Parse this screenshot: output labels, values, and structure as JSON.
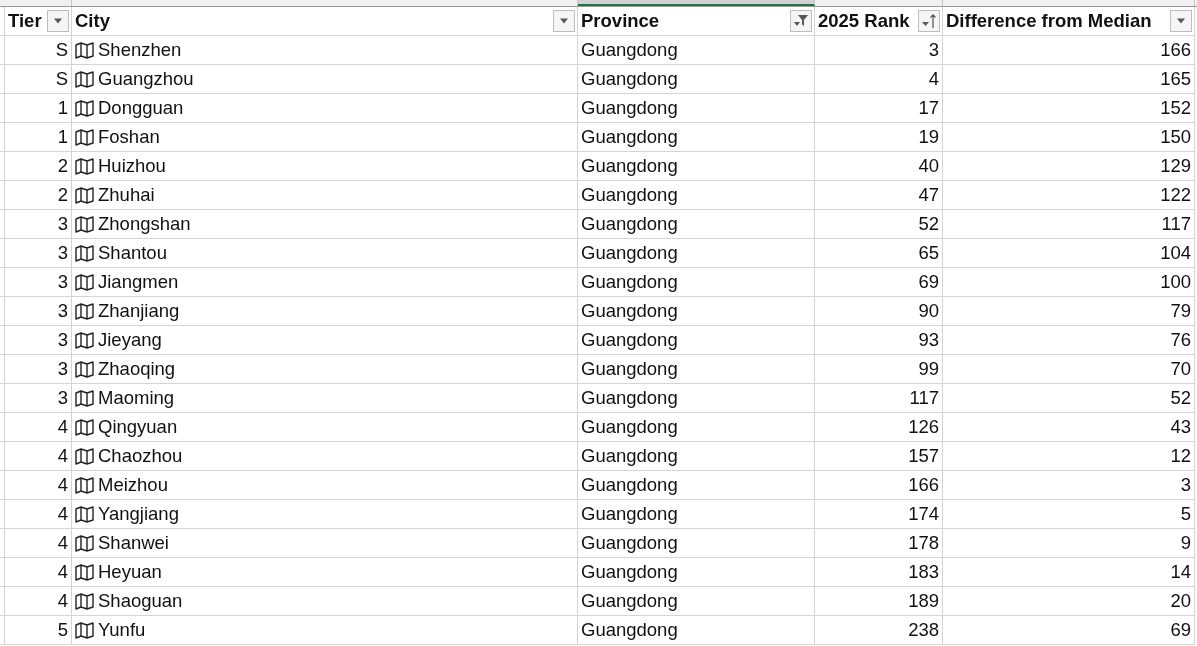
{
  "columns": [
    {
      "label": "Tier",
      "kind": "dropdown",
      "selected": false
    },
    {
      "label": "City",
      "kind": "dropdown",
      "selected": false
    },
    {
      "label": "Province",
      "kind": "filtered",
      "selected": true
    },
    {
      "label": "2025 Rank",
      "kind": "sorted",
      "selected": false
    },
    {
      "label": "Difference from Median",
      "kind": "dropdown",
      "selected": false
    }
  ],
  "rows": [
    {
      "tier": "S",
      "city": "Shenzhen",
      "province": "Guangdong",
      "rank": "3",
      "difference": "166"
    },
    {
      "tier": "S",
      "city": "Guangzhou",
      "province": "Guangdong",
      "rank": "4",
      "difference": "165"
    },
    {
      "tier": "1",
      "city": "Dongguan",
      "province": "Guangdong",
      "rank": "17",
      "difference": "152"
    },
    {
      "tier": "1",
      "city": "Foshan",
      "province": "Guangdong",
      "rank": "19",
      "difference": "150"
    },
    {
      "tier": "2",
      "city": "Huizhou",
      "province": "Guangdong",
      "rank": "40",
      "difference": "129"
    },
    {
      "tier": "2",
      "city": "Zhuhai",
      "province": "Guangdong",
      "rank": "47",
      "difference": "122"
    },
    {
      "tier": "3",
      "city": "Zhongshan",
      "province": "Guangdong",
      "rank": "52",
      "difference": "117"
    },
    {
      "tier": "3",
      "city": "Shantou",
      "province": "Guangdong",
      "rank": "65",
      "difference": "104"
    },
    {
      "tier": "3",
      "city": "Jiangmen",
      "province": "Guangdong",
      "rank": "69",
      "difference": "100"
    },
    {
      "tier": "3",
      "city": "Zhanjiang",
      "province": "Guangdong",
      "rank": "90",
      "difference": "79"
    },
    {
      "tier": "3",
      "city": "Jieyang",
      "province": "Guangdong",
      "rank": "93",
      "difference": "76"
    },
    {
      "tier": "3",
      "city": "Zhaoqing",
      "province": "Guangdong",
      "rank": "99",
      "difference": "70"
    },
    {
      "tier": "3",
      "city": "Maoming",
      "province": "Guangdong",
      "rank": "117",
      "difference": "52"
    },
    {
      "tier": "4",
      "city": "Qingyuan",
      "province": "Guangdong",
      "rank": "126",
      "difference": "43"
    },
    {
      "tier": "4",
      "city": "Chaozhou",
      "province": "Guangdong",
      "rank": "157",
      "difference": "12"
    },
    {
      "tier": "4",
      "city": "Meizhou",
      "province": "Guangdong",
      "rank": "166",
      "difference": "3"
    },
    {
      "tier": "4",
      "city": "Yangjiang",
      "province": "Guangdong",
      "rank": "174",
      "difference": "5"
    },
    {
      "tier": "4",
      "city": "Shanwei",
      "province": "Guangdong",
      "rank": "178",
      "difference": "9"
    },
    {
      "tier": "4",
      "city": "Heyuan",
      "province": "Guangdong",
      "rank": "183",
      "difference": "14"
    },
    {
      "tier": "4",
      "city": "Shaoguan",
      "province": "Guangdong",
      "rank": "189",
      "difference": "20"
    },
    {
      "tier": "5",
      "city": "Yunfu",
      "province": "Guangdong",
      "rank": "238",
      "difference": "69"
    }
  ]
}
